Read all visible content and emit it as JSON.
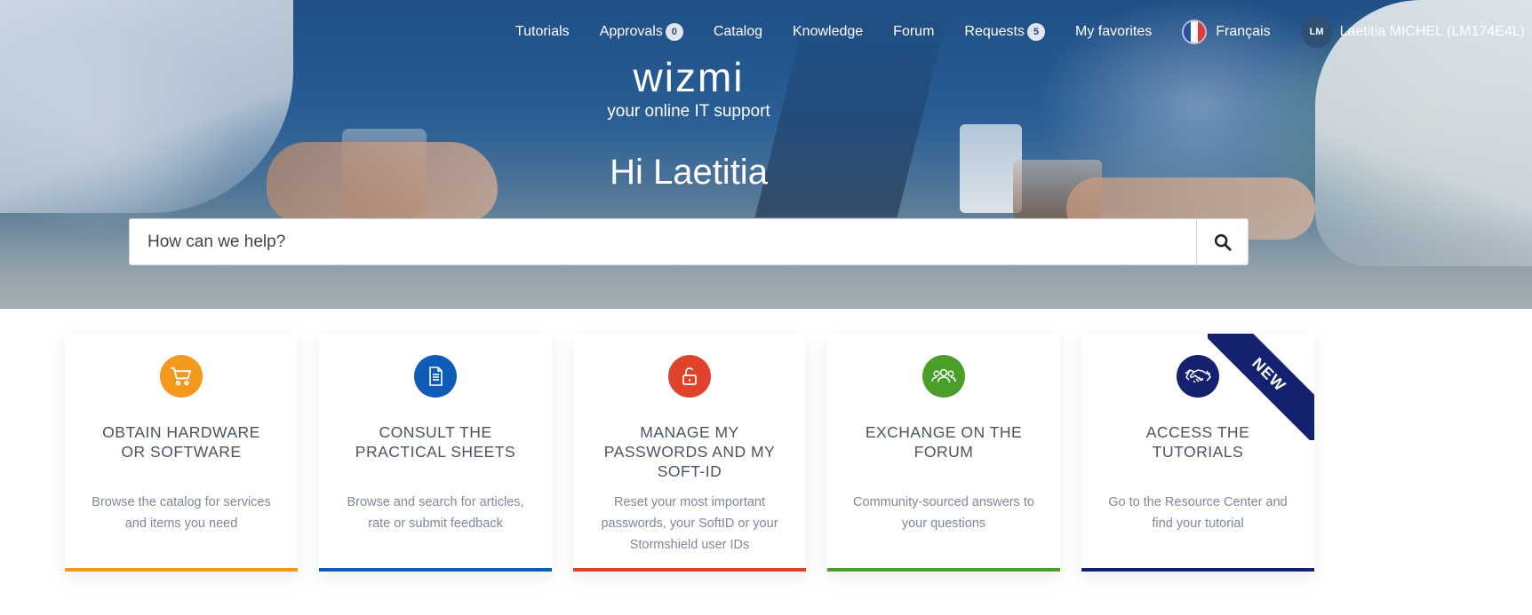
{
  "nav": {
    "items": [
      {
        "label": "Tutorials"
      },
      {
        "label": "Approvals",
        "badge": "0"
      },
      {
        "label": "Catalog"
      },
      {
        "label": "Knowledge"
      },
      {
        "label": "Forum"
      },
      {
        "label": "Requests",
        "badge": "5"
      },
      {
        "label": "My favorites"
      }
    ],
    "language": {
      "label": "Français",
      "icon": "french-flag-icon"
    },
    "user": {
      "initials": "LM",
      "name": "Laetitia MICHEL (LM174E4L)"
    }
  },
  "hero": {
    "logo": "wizmi",
    "tagline": "your online IT support",
    "greeting": "Hi Laetitia"
  },
  "search": {
    "placeholder": "How can we help?",
    "icon": "search-icon"
  },
  "cards": [
    {
      "title_line1": "OBTAIN HARDWARE",
      "title_line2": "OR SOFTWARE",
      "title_line3": "",
      "desc_line1": "Browse the catalog for services",
      "desc_line2": "and items you need",
      "desc_line3": "",
      "color": "#f39a1e",
      "icon": "shopping-cart-icon"
    },
    {
      "title_line1": "CONSULT THE",
      "title_line2": "PRACTICAL SHEETS",
      "title_line3": "",
      "desc_line1": "Browse and search for articles,",
      "desc_line2": "rate or submit feedback",
      "desc_line3": "",
      "color": "#0e5bb8",
      "icon": "document-icon"
    },
    {
      "title_line1": "MANAGE MY",
      "title_line2": "PASSWORDS AND MY",
      "title_line3": "SOFT-ID",
      "desc_line1": "Reset your most important",
      "desc_line2": "passwords, your SoftID or your",
      "desc_line3": "Stormshield user IDs",
      "color": "#e0432b",
      "icon": "unlock-icon"
    },
    {
      "title_line1": "EXCHANGE ON THE",
      "title_line2": "FORUM",
      "title_line3": "",
      "desc_line1": "Community-sourced answers to",
      "desc_line2": "your questions",
      "desc_line3": "",
      "color": "#4a9e2a",
      "icon": "users-icon"
    },
    {
      "title_line1": "ACCESS THE",
      "title_line2": "TUTORIALS",
      "title_line3": "",
      "desc_line1": "Go to the Resource Center and",
      "desc_line2": "find your tutorial",
      "desc_line3": "",
      "color": "#14216f",
      "icon": "handshake-icon",
      "ribbon": "NEW"
    }
  ]
}
